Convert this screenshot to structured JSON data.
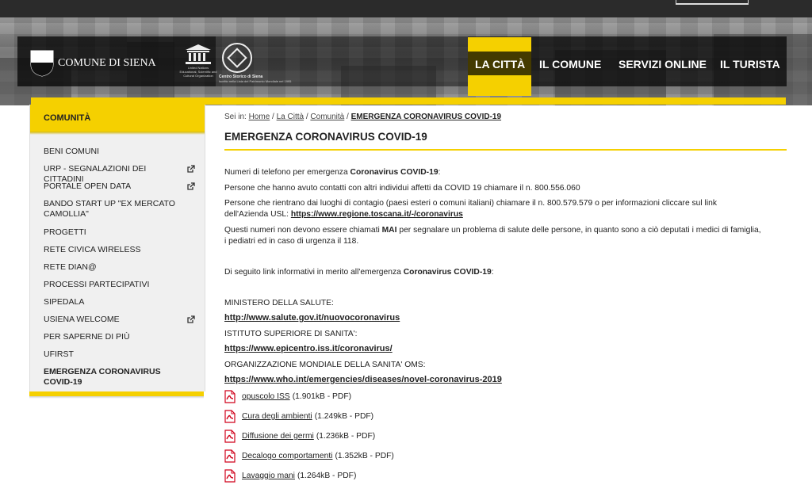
{
  "header": {
    "site_name": "COMUNE DI SIENA",
    "unesco_caption": "United Nations Educational, Scientific and Cultural Organization",
    "heritage_title": "Centro Storico di Siena",
    "heritage_sub": "Iscritto nella Lista del Patrimonio Mondiale nel 1995",
    "nav": [
      {
        "label": "LA CITTÀ",
        "active": true
      },
      {
        "label": "IL COMUNE",
        "active": false
      },
      {
        "label": "SERVIZI ONLINE",
        "active": false
      },
      {
        "label": "IL TURISTA",
        "active": false
      }
    ]
  },
  "sidebar": {
    "heading": "COMUNITÀ",
    "items": [
      {
        "label": "BENI COMUNI",
        "external": false
      },
      {
        "label": "URP - SEGNALAZIONI DEI CITTADINI",
        "external": true
      },
      {
        "label": "PORTALE OPEN DATA",
        "external": true
      },
      {
        "label": "BANDO START UP \"EX MERCATO CAMOLLIA\"",
        "external": false
      },
      {
        "label": "PROGETTI",
        "external": false
      },
      {
        "label": "RETE CIVICA WIRELESS",
        "external": false
      },
      {
        "label": "RETE DIAN@",
        "external": false
      },
      {
        "label": "PROCESSI PARTECIPATIVI",
        "external": false
      },
      {
        "label": "SIPEDALA",
        "external": false
      },
      {
        "label": "USIENA WELCOME",
        "external": true
      },
      {
        "label": "PER SAPERNE DI PIÙ",
        "external": false
      },
      {
        "label": "UFIRST",
        "external": false
      },
      {
        "label": "EMERGENZA CORONAVIRUS COVID-19",
        "external": false,
        "current": true
      }
    ]
  },
  "breadcrumb": {
    "prefix": "Sei in:",
    "items": [
      "Home",
      "La Città",
      "Comunità"
    ],
    "current": "EMERGENZA CORONAVIRUS COVID-19"
  },
  "page": {
    "title": "EMERGENZA CORONAVIRUS COVID-19",
    "intro_pre": "Numeri di telefono per emergenza ",
    "intro_bold": "Coronavirus COVID-19",
    "intro_post": ":",
    "p1": "Persone che hanno avuto contatti con altri individui affetti da COVID 19 chiamare il n. 800.556.060",
    "p2_line1": "Persone che rientrano dai luoghi di contagio (paesi esteri o comuni italiani) chiamare il n. 800.579.579 o per informazioni cliccare sul link",
    "p2_line2_pre": "dell'Azienda USL:  ",
    "p2_link": "https://www.regione.toscana.it/-/coronavirus",
    "p3_pre": "Questi numeri non devono essere chiamati ",
    "p3_bold": "MAI",
    "p3_post": " per segnalare un problema di salute delle persone, in quanto sono a ciò deputati i medici di famiglia,",
    "p3_line2": "i pediatri ed in caso di urgenza il 118.",
    "links_intro_pre": "Di seguito link informativi in merito all'emergenza ",
    "links_intro_bold": "Coronavirus COVID-19",
    "links_intro_post": ":",
    "sources": [
      {
        "label": "MINISTERO DELLA SALUTE:",
        "url": "http://www.salute.gov.it/nuovocoronavirus"
      },
      {
        "label": "ISTITUTO SUPERIORE DI SANITA':",
        "url": "https://www.epicentro.iss.it/coronavirus/"
      },
      {
        "label": "ORGANIZZAZIONE MONDIALE DELLA SANITA' OMS:",
        "url": "https://www.who.int/emergencies/diseases/novel-coronavirus-2019"
      }
    ],
    "attachments": [
      {
        "name": "opuscolo ISS",
        "meta": "(1.901kB - PDF)"
      },
      {
        "name": "Cura degli ambienti",
        "meta": "(1.249kB - PDF)"
      },
      {
        "name": "Diffusione dei germi",
        "meta": "(1.236kB - PDF)"
      },
      {
        "name": "Decalogo comportamenti",
        "meta": "(1.352kB - PDF)"
      },
      {
        "name": "Lavaggio mani",
        "meta": "(1.264kB - PDF)"
      }
    ]
  },
  "colors": {
    "accent": "#f5d000",
    "pdf_red": "#d0021b"
  }
}
